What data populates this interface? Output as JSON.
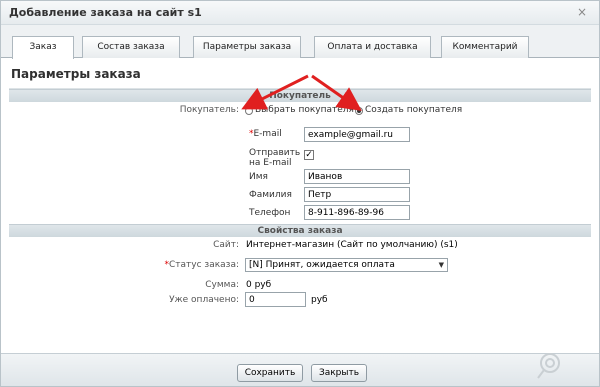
{
  "window": {
    "title": "Добавление заказа на сайт s1",
    "close_glyph": "×"
  },
  "tabs": [
    {
      "label": "Заказ",
      "active": true
    },
    {
      "label": "Состав заказа",
      "active": false
    },
    {
      "label": "Параметры заказа",
      "active": false
    },
    {
      "label": "Оплата и доставка",
      "active": false
    },
    {
      "label": "Комментарий",
      "active": false
    }
  ],
  "content": {
    "section_title": "Параметры заказа",
    "buyer": {
      "header": "Покупатель",
      "buyer_label": "Покупатель:",
      "option_select": "Выбрать покупателя",
      "option_create": "Создать покупателя",
      "selected_option": "create",
      "email_label": "E-mail",
      "email_required_mark": "*",
      "email_value": "example@gmail.ru",
      "send_email_label": "Отправить на E-mail",
      "send_email_checked": true,
      "send_email_check_glyph": "✓",
      "name_label": "Имя",
      "name_value": "Иванов",
      "surname_label": "Фамилия",
      "surname_value": "Петр",
      "phone_label": "Телефон",
      "phone_value": "8-911-896-89-96"
    },
    "order_props": {
      "header": "Свойства заказа",
      "site_label": "Сайт:",
      "site_value": "Интернет-магазин (Сайт по умолчанию) (s1)",
      "status_label": "Статус заказа:",
      "status_required_mark": "*",
      "status_value": "[N] Принят, ожидается оплата",
      "status_arrow_glyph": "▼",
      "sum_label": "Сумма:",
      "sum_value": "0 руб",
      "paid_label": "Уже оплачено:",
      "paid_value": "0",
      "paid_unit": "руб"
    }
  },
  "footer": {
    "save_label": "Сохранить",
    "close_label": "Закрыть"
  },
  "colors": {
    "annotation_arrow": "#e02020"
  }
}
